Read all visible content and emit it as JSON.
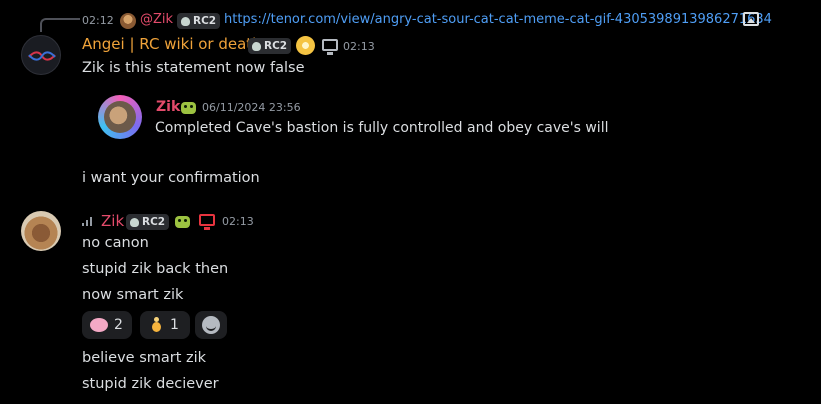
{
  "reply_preview": {
    "timestamp": "02:12",
    "author": "@Zik",
    "tag": "RC2",
    "link": "https://tenor.com/view/angry-cat-sour-cat-cat-meme-cat-gif-4305398913986271634",
    "attachment_icon": "image-icon"
  },
  "message_1": {
    "author": "Angei | RC wiki or death",
    "tag": "RC2",
    "timestamp": "02:13",
    "text": "Zik is this statement now false",
    "embed": {
      "author": "Zik",
      "date": "06/11/2024 23:56",
      "text": "Completed Cave's bastion is fully controlled and obey cave's will"
    },
    "followup": "i want your confirmation"
  },
  "message_2": {
    "author": "Zik",
    "tag": "RC2",
    "timestamp": "02:13",
    "lines": [
      "no canon",
      "stupid zik back then",
      "now smart zik"
    ],
    "reactions": [
      {
        "emoji": "brain",
        "count": "2"
      },
      {
        "emoji": "praying-hands",
        "count": "1"
      }
    ],
    "more_lines": [
      "believe smart zik",
      "stupid zik deciever"
    ]
  },
  "colors": {
    "background": "#000000",
    "zik_name": "#e34b6b",
    "angei_name": "#f0a33a",
    "link": "#4f9ef5"
  }
}
